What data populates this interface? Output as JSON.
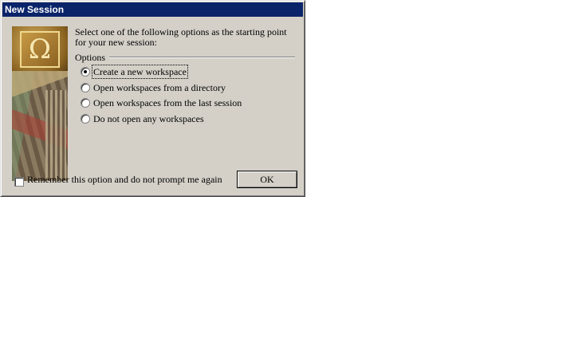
{
  "window": {
    "title": "New Session"
  },
  "instructions": "Select one of the following options as the starting point for your new session:",
  "options_group": {
    "legend": "Options",
    "items": [
      {
        "label": "Create a new workspace",
        "selected": true
      },
      {
        "label": "Open workspaces from a directory",
        "selected": false
      },
      {
        "label": "Open workspaces from the last session",
        "selected": false
      },
      {
        "label": "Do not open any workspaces",
        "selected": false
      }
    ]
  },
  "remember_checkbox": {
    "label": "Remember this option and do not prompt me again",
    "checked": false
  },
  "buttons": {
    "ok": "OK"
  },
  "logo": {
    "glyph": "Ω"
  },
  "colors": {
    "titlebar": "#0a246a",
    "dialog_bg": "#d4d0c8"
  }
}
